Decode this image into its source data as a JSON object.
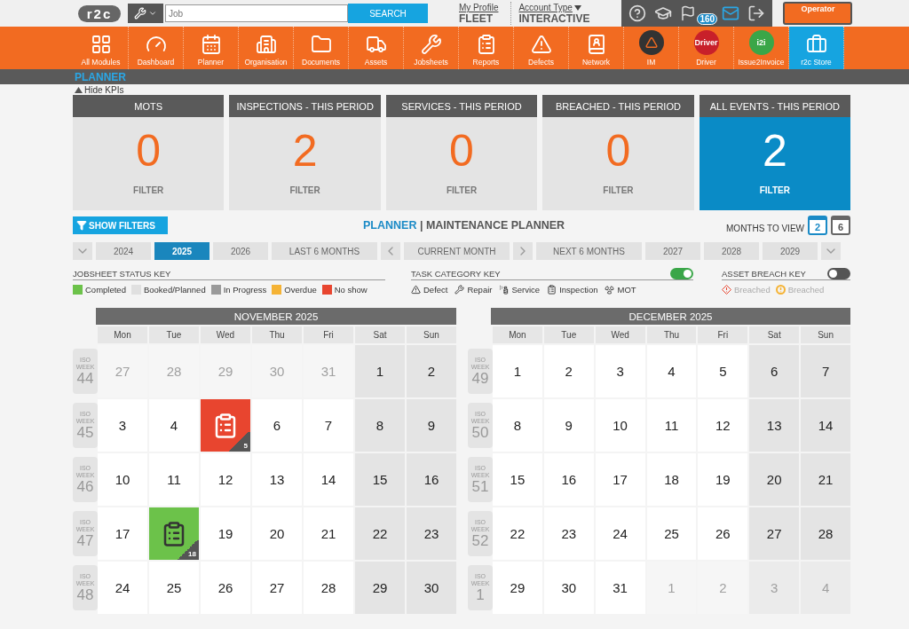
{
  "topbar": {
    "logo": "r2c",
    "search": {
      "placeholder": "Job",
      "button": "SEARCH"
    },
    "profile": {
      "link": "My Profile",
      "value": "FLEET"
    },
    "account": {
      "link": "Account Type",
      "value": "INTERACTIVE"
    },
    "notification_count": "160",
    "operator": "Operator"
  },
  "nav": [
    {
      "label": "All Modules",
      "kind": "grid",
      "selected": false
    },
    {
      "label": "Dashboard",
      "kind": "gauge",
      "selected": false
    },
    {
      "label": "Planner",
      "kind": "calendar",
      "selected": false
    },
    {
      "label": "Organisation",
      "kind": "buildings",
      "selected": false
    },
    {
      "label": "Documents",
      "kind": "folder",
      "selected": false
    },
    {
      "label": "Assets",
      "kind": "truck",
      "selected": false
    },
    {
      "label": "Jobsheets",
      "kind": "tools",
      "selected": false
    },
    {
      "label": "Reports",
      "kind": "clipboard",
      "selected": false
    },
    {
      "label": "Defects",
      "kind": "warning",
      "selected": false
    },
    {
      "label": "Network",
      "kind": "contacts",
      "selected": false
    },
    {
      "label": "IM",
      "kind": "im",
      "selected": false
    },
    {
      "label": "Driver",
      "kind": "badge",
      "badge": "Driver",
      "color": "#c8202a",
      "selected": false
    },
    {
      "label": "Issue2Invoice",
      "kind": "badge",
      "badge": "i2i",
      "color": "#3aa648",
      "selected": false
    },
    {
      "label": "r2c Store",
      "kind": "briefcase",
      "selected": true
    }
  ],
  "section_title": "PLANNER",
  "hide_kpis": "Hide KPIs",
  "kpis": [
    {
      "title": "MOTS",
      "value": "0",
      "filter": "FILTER",
      "selected": false
    },
    {
      "title": "INSPECTIONS - THIS PERIOD",
      "value": "2",
      "filter": "FILTER",
      "selected": false
    },
    {
      "title": "SERVICES - THIS PERIOD",
      "value": "0",
      "filter": "FILTER",
      "selected": false
    },
    {
      "title": "BREACHED - THIS PERIOD",
      "value": "0",
      "filter": "FILTER",
      "selected": false
    },
    {
      "title": "ALL EVENTS - THIS PERIOD",
      "value": "2",
      "filter": "FILTER",
      "selected": true
    }
  ],
  "show_filters": "SHOW FILTERS",
  "planner_title": {
    "main": "PLANNER",
    "separator": "|",
    "sub": "MAINTENANCE PLANNER"
  },
  "months_to_view": {
    "label": "MONTHS TO VIEW",
    "options": [
      {
        "label": "2",
        "selected": true
      },
      {
        "label": "6",
        "selected": false
      }
    ]
  },
  "period_nav": [
    {
      "kind": "arrow-down"
    },
    {
      "kind": "button",
      "label": "2024",
      "selected": false
    },
    {
      "kind": "button",
      "label": "2025",
      "selected": true
    },
    {
      "kind": "button",
      "label": "2026",
      "selected": false
    },
    {
      "kind": "wide",
      "label": "LAST 6 MONTHS",
      "selected": false
    },
    {
      "kind": "arrow-left"
    },
    {
      "kind": "wide",
      "label": "CURRENT MONTH",
      "selected": false
    },
    {
      "kind": "arrow-right"
    },
    {
      "kind": "wide",
      "label": "NEXT 6 MONTHS",
      "selected": false
    },
    {
      "kind": "button",
      "label": "2027",
      "selected": false
    },
    {
      "kind": "button",
      "label": "2028",
      "selected": false
    },
    {
      "kind": "button",
      "label": "2029",
      "selected": false
    },
    {
      "kind": "arrow-down"
    }
  ],
  "status_key": {
    "title": "JOBSHEET STATUS KEY",
    "items": [
      {
        "label": "Completed",
        "color": "#6cc24a"
      },
      {
        "label": "Booked/Planned",
        "color": "#e0e0e0"
      },
      {
        "label": "In Progress",
        "color": "#9a9a9a"
      },
      {
        "label": "Overdue",
        "color": "#f5b335"
      },
      {
        "label": "No show",
        "color": "#e8452f"
      }
    ]
  },
  "task_key": {
    "title": "TASK CATEGORY KEY",
    "on": true,
    "items": [
      {
        "label": "Defect",
        "kind": "warning"
      },
      {
        "label": "Repair",
        "kind": "tools"
      },
      {
        "label": "Service",
        "kind": "spray"
      },
      {
        "label": "Inspection",
        "kind": "clipboard"
      },
      {
        "label": "MOT",
        "kind": "radiation"
      }
    ]
  },
  "breach_key": {
    "title": "ASSET BREACH KEY",
    "on": false,
    "items": [
      {
        "label": "Breached",
        "kind": "diamond",
        "color": "#e8452f"
      },
      {
        "label": "Breached",
        "kind": "circle",
        "color": "#f5b335"
      }
    ]
  },
  "months": [
    {
      "title": "NOVEMBER 2025",
      "weekdays": [
        "Mon",
        "Tue",
        "Wed",
        "Thu",
        "Fri",
        "Sat",
        "Sun"
      ],
      "weeks": [
        {
          "iso": "ISO WEEK",
          "week": "44",
          "days": [
            {
              "day": "27",
              "outside": true
            },
            {
              "day": "28",
              "outside": true
            },
            {
              "day": "29",
              "outside": true
            },
            {
              "day": "30",
              "outside": true
            },
            {
              "day": "31",
              "outside": true
            },
            {
              "day": "1",
              "outside": false
            },
            {
              "day": "2",
              "outside": false
            }
          ]
        },
        {
          "iso": "ISO WEEK",
          "week": "45",
          "days": [
            {
              "day": "3",
              "outside": false
            },
            {
              "day": "4",
              "outside": false
            },
            {
              "event": {
                "color": "#e8452f",
                "count": "5"
              }
            },
            {
              "day": "6",
              "outside": false
            },
            {
              "day": "7",
              "outside": false
            },
            {
              "day": "8",
              "outside": false
            },
            {
              "day": "9",
              "outside": false
            }
          ]
        },
        {
          "iso": "ISO WEEK",
          "week": "46",
          "days": [
            {
              "day": "10",
              "outside": false
            },
            {
              "day": "11",
              "outside": false
            },
            {
              "day": "12",
              "outside": false
            },
            {
              "day": "13",
              "outside": false
            },
            {
              "day": "14",
              "outside": false
            },
            {
              "day": "15",
              "outside": false
            },
            {
              "day": "16",
              "outside": false
            }
          ]
        },
        {
          "iso": "ISO WEEK",
          "week": "47",
          "days": [
            {
              "day": "17",
              "outside": false
            },
            {
              "event": {
                "color": "#6cc24a",
                "count": "18"
              }
            },
            {
              "day": "19",
              "outside": false
            },
            {
              "day": "20",
              "outside": false
            },
            {
              "day": "21",
              "outside": false
            },
            {
              "day": "22",
              "outside": false
            },
            {
              "day": "23",
              "outside": false
            }
          ]
        },
        {
          "iso": "ISO WEEK",
          "week": "48",
          "days": [
            {
              "day": "24",
              "outside": false
            },
            {
              "day": "25",
              "outside": false
            },
            {
              "day": "26",
              "outside": false
            },
            {
              "day": "27",
              "outside": false
            },
            {
              "day": "28",
              "outside": false
            },
            {
              "day": "29",
              "outside": false
            },
            {
              "day": "30",
              "outside": false
            }
          ]
        }
      ]
    },
    {
      "title": "DECEMBER 2025",
      "weekdays": [
        "Mon",
        "Tue",
        "Wed",
        "Thu",
        "Fri",
        "Sat",
        "Sun"
      ],
      "weeks": [
        {
          "iso": "ISO WEEK",
          "week": "49",
          "days": [
            {
              "day": "1",
              "outside": false
            },
            {
              "day": "2",
              "outside": false
            },
            {
              "day": "3",
              "outside": false
            },
            {
              "day": "4",
              "outside": false
            },
            {
              "day": "5",
              "outside": false
            },
            {
              "day": "6",
              "outside": false
            },
            {
              "day": "7",
              "outside": false
            }
          ]
        },
        {
          "iso": "ISO WEEK",
          "week": "50",
          "days": [
            {
              "day": "8",
              "outside": false
            },
            {
              "day": "9",
              "outside": false
            },
            {
              "day": "10",
              "outside": false
            },
            {
              "day": "11",
              "outside": false
            },
            {
              "day": "12",
              "outside": false
            },
            {
              "day": "13",
              "outside": false
            },
            {
              "day": "14",
              "outside": false
            }
          ]
        },
        {
          "iso": "ISO WEEK",
          "week": "51",
          "days": [
            {
              "day": "15",
              "outside": false
            },
            {
              "day": "16",
              "outside": false
            },
            {
              "day": "17",
              "outside": false
            },
            {
              "day": "18",
              "outside": false
            },
            {
              "day": "19",
              "outside": false
            },
            {
              "day": "20",
              "outside": false
            },
            {
              "day": "21",
              "outside": false
            }
          ]
        },
        {
          "iso": "ISO WEEK",
          "week": "52",
          "days": [
            {
              "day": "22",
              "outside": false
            },
            {
              "day": "23",
              "outside": false
            },
            {
              "day": "24",
              "outside": false
            },
            {
              "day": "25",
              "outside": false
            },
            {
              "day": "26",
              "outside": false
            },
            {
              "day": "27",
              "outside": false
            },
            {
              "day": "28",
              "outside": false
            }
          ]
        },
        {
          "iso": "ISO WEEK",
          "week": "1",
          "days": [
            {
              "day": "29",
              "outside": false
            },
            {
              "day": "30",
              "outside": false
            },
            {
              "day": "31",
              "outside": false
            },
            {
              "day": "1",
              "outside": true
            },
            {
              "day": "2",
              "outside": true
            },
            {
              "day": "3",
              "outside": true
            },
            {
              "day": "4",
              "outside": true
            }
          ]
        }
      ]
    }
  ]
}
